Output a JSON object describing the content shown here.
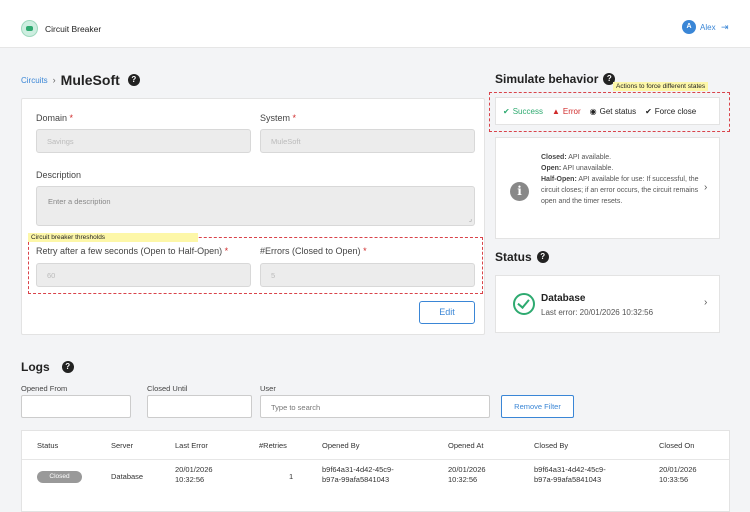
{
  "app": {
    "title": "Circuit Breaker",
    "user_initial": "A",
    "user_name": "Alex"
  },
  "breadcrumb": {
    "link": "Circuits",
    "separator": "›",
    "title": "MuleSoft"
  },
  "form": {
    "domain_label": "Domain",
    "domain_value": "Savings",
    "system_label": "System",
    "system_value": "MuleSoft",
    "description_label": "Description",
    "description_placeholder": "Enter a description",
    "thresholds_annotation": "Circuit breaker thresholds",
    "retry_label": "Retry after a few seconds (Open to Half-Open)",
    "retry_value": "60",
    "errors_label": "#Errors (Closed to Open)",
    "errors_value": "5",
    "required_mark": "*",
    "edit_label": "Edit"
  },
  "simulate": {
    "title": "Simulate behavior",
    "annotation": "Actions to force different states",
    "options": [
      "Success",
      "Error",
      "Get status",
      "Force close"
    ],
    "info": {
      "closed_label": "Closed:",
      "closed_text": "API available.",
      "open_label": "Open:",
      "open_text": "API unavailable.",
      "half_label": "Half-Open:",
      "half_text": "API available for use: If successful, the circuit closes; if an error occurs, the circuit remains open and the timer resets."
    }
  },
  "status": {
    "title": "Status",
    "name": "Database",
    "last_error": "Last error: 20/01/2026 10:32:56"
  },
  "logs": {
    "title": "Logs",
    "filters": {
      "opened_from": "Opened From",
      "closed_until": "Closed Until",
      "user": "User",
      "user_placeholder": "Type to search",
      "remove_label": "Remove Filter"
    },
    "columns": [
      "Status",
      "Server",
      "Last Error",
      "#Retries",
      "Opened By",
      "Opened At",
      "Closed By",
      "Closed On"
    ],
    "rows": [
      {
        "status": "Closed",
        "server": "Database",
        "last_error_1": "20/01/2026",
        "last_error_2": "10:32:56",
        "retries": "1",
        "opened_by_1": "b9f64a31-4d42-45c9-",
        "opened_by_2": "b97a-99afa5841043",
        "opened_at_1": "20/01/2026",
        "opened_at_2": "10:32:56",
        "closed_by_1": "b9f64a31-4d42-45c9-",
        "closed_by_2": "b97a-99afa5841043",
        "closed_on_1": "20/01/2026",
        "closed_on_2": "10:33:56"
      }
    ]
  },
  "colors": {
    "accent": "#3a86d6",
    "success": "#2eaa70",
    "error": "#d02a2a",
    "highlight": "#fdf7a8"
  }
}
